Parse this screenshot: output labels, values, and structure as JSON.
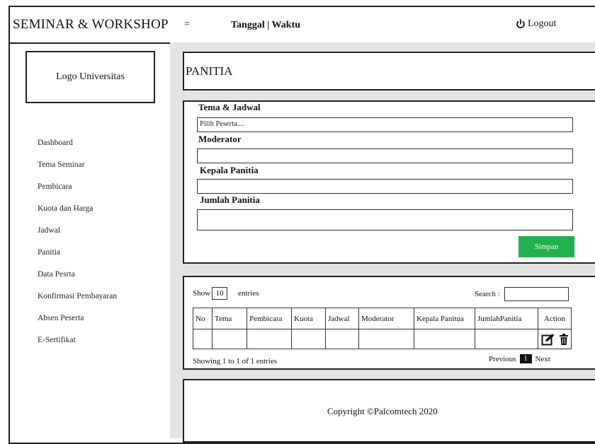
{
  "header": {
    "brand": "SEMINAR & WORKSHOP",
    "menu_toggle": "=",
    "datetime": "Tanggal | Waktu",
    "logout_label": "Logout",
    "logout_icon": "power-icon"
  },
  "sidebar": {
    "logo_text": "Logo Universitas",
    "items": [
      {
        "label": "Dashboard"
      },
      {
        "label": "Tema Seminar"
      },
      {
        "label": "Pembicara"
      },
      {
        "label": "Kuota dan Harga"
      },
      {
        "label": "Jadwal"
      },
      {
        "label": "Panitia"
      },
      {
        "label": "Data Pesrta"
      },
      {
        "label": "Konfirmasi Pembayaran"
      },
      {
        "label": "Absen Peserta"
      },
      {
        "label": "E-Sertifikat"
      }
    ]
  },
  "page": {
    "title": "PANITIA"
  },
  "form": {
    "tema_label": "Tema & Jadwal",
    "tema_placeholder": "Pilih Peserta....",
    "moderator_label": "Moderator",
    "moderator_value": "",
    "kepala_label": "Kepala Panitia",
    "kepala_value": "",
    "jumlah_label": "Jumlah Panitia",
    "jumlah_value": "",
    "save_label": "Simpan",
    "save_color": "#22b14c"
  },
  "table": {
    "show_label": "Show",
    "show_value": "10",
    "entries_label": "entries",
    "search_label": "Search :",
    "columns": [
      "No",
      "Tema",
      "Pembicara",
      "Kuota",
      "Jadwal",
      "Moderator",
      "Kepala Panitua",
      "JumlahPanitia",
      "Action"
    ],
    "row_actions": [
      "edit-icon",
      "trash-icon"
    ],
    "info": "Showing 1 to 1 of 1 entries",
    "prev_label": "Previous",
    "page_number": "1",
    "next_label": "Next"
  },
  "footer": {
    "copyright": "Copyright ©Palcomtech 2020"
  }
}
